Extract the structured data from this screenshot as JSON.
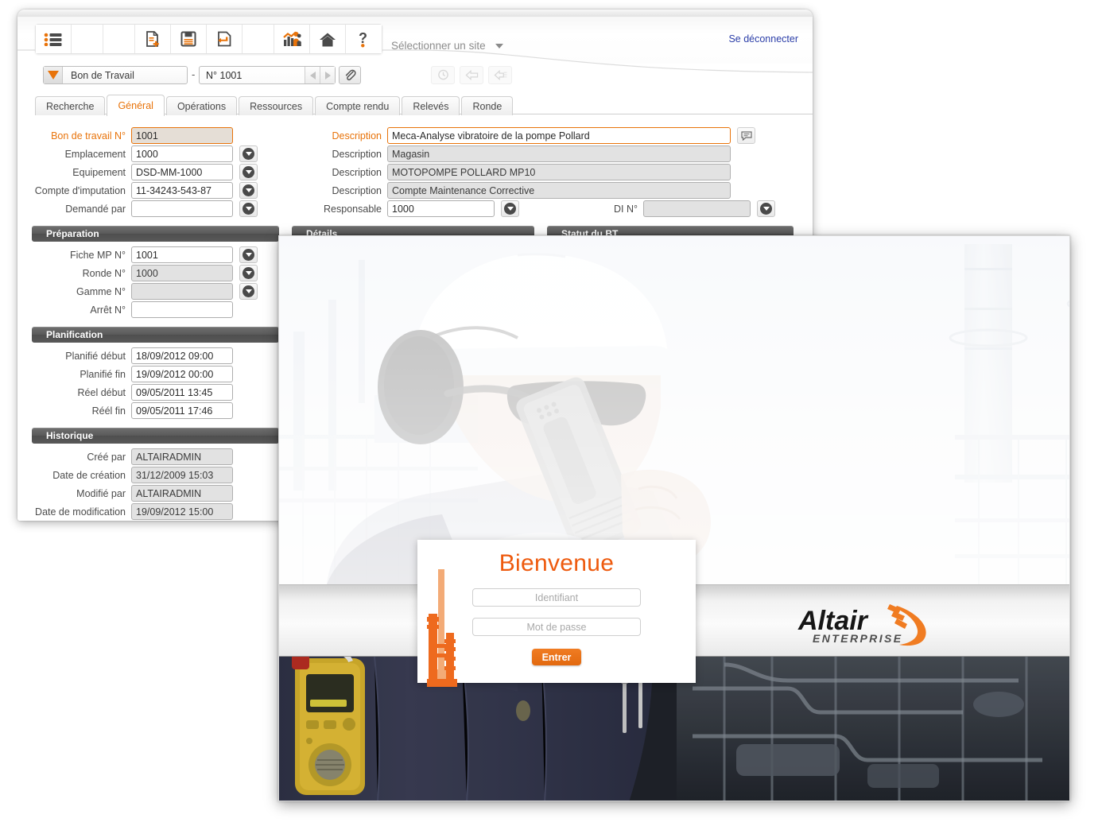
{
  "app": {
    "toolbar": [
      {
        "icon": "list-icon",
        "name": "list"
      },
      {
        "icon": "blank-icon",
        "name": "blank1"
      },
      {
        "icon": "blank-icon",
        "name": "blank2"
      },
      {
        "icon": "new-document-icon",
        "name": "new"
      },
      {
        "icon": "save-floppy-icon",
        "name": "save"
      },
      {
        "icon": "undo-return-icon",
        "name": "undo"
      },
      {
        "icon": "blank-icon",
        "name": "blank3"
      },
      {
        "icon": "chart-people-icon",
        "name": "reports"
      },
      {
        "icon": "home-icon",
        "name": "home"
      },
      {
        "icon": "help-question-icon",
        "name": "help"
      }
    ],
    "site_selector": "Sélectionner un site",
    "logout": "Se déconnecter",
    "record": {
      "type": "Bon de Travail",
      "separator": "-",
      "number": "N° 1001"
    },
    "tabs": [
      {
        "label": "Recherche",
        "active": false
      },
      {
        "label": "Général",
        "active": true
      },
      {
        "label": "Opérations",
        "active": false
      },
      {
        "label": "Ressources",
        "active": false
      },
      {
        "label": "Compte rendu",
        "active": false
      },
      {
        "label": "Relevés",
        "active": false
      },
      {
        "label": "Ronde",
        "active": false
      }
    ],
    "form": {
      "left_top": [
        {
          "label": "Bon de travail N°",
          "value": "1001",
          "state": "focus",
          "dropdown": false,
          "highlight": true
        },
        {
          "label": "Emplacement",
          "value": "1000",
          "state": "normal",
          "dropdown": true,
          "highlight": false
        },
        {
          "label": "Equipement",
          "value": "DSD-MM-1000",
          "state": "normal",
          "dropdown": true,
          "highlight": false
        },
        {
          "label": "Compte d'imputation",
          "value": "11-34243-543-87",
          "state": "normal",
          "dropdown": true,
          "highlight": false
        },
        {
          "label": "Demandé par",
          "value": "",
          "state": "normal",
          "dropdown": true,
          "highlight": false
        }
      ],
      "right_top": [
        {
          "label": "Description",
          "value": "Meca-Analyse vibratoire de la pompe Pollard",
          "state": "focus",
          "highlight": true,
          "comment": true
        },
        {
          "label": "Description",
          "value": "Magasin",
          "state": "readonly",
          "highlight": false,
          "comment": false
        },
        {
          "label": "Description",
          "value": "MOTOPOMPE POLLARD MP10",
          "state": "readonly",
          "highlight": false,
          "comment": false
        },
        {
          "label": "Description",
          "value": "Compte Maintenance Corrective",
          "state": "readonly",
          "highlight": false,
          "comment": false
        }
      ],
      "responsable": {
        "label": "Responsable",
        "value": "1000"
      },
      "di": {
        "label": "DI N°",
        "value": ""
      },
      "sections": [
        {
          "title": "Préparation"
        },
        {
          "title": "Détails"
        },
        {
          "title": "Statut du BT"
        },
        {
          "title": "Planification"
        },
        {
          "title": "Historique"
        }
      ],
      "preparation": [
        {
          "label": "Fiche MP N°",
          "value": "1001",
          "state": "normal",
          "dropdown": true
        },
        {
          "label": "Ronde N°",
          "value": "1000",
          "state": "readonly",
          "dropdown": true
        },
        {
          "label": "Gamme N°",
          "value": "",
          "state": "readonly",
          "dropdown": true
        },
        {
          "label": "Arrêt N°",
          "value": "",
          "state": "normal",
          "dropdown": false
        }
      ],
      "planification": [
        {
          "label": "Planifié début",
          "value": "18/09/2012 09:00"
        },
        {
          "label": "Planifié fin",
          "value": "19/09/2012 00:00"
        },
        {
          "label": "Réel début",
          "value": "09/05/2011 13:45"
        },
        {
          "label": "Réél fin",
          "value": "09/05/2011 17:46"
        }
      ],
      "historique": [
        {
          "label": "Créé par",
          "value": "ALTAIRADMIN"
        },
        {
          "label": "Date de création",
          "value": "31/12/2009 15:03"
        },
        {
          "label": "Modifié par",
          "value": "ALTAIRADMIN"
        },
        {
          "label": "Date de modification",
          "value": "19/09/2012 15:00"
        }
      ]
    }
  },
  "login": {
    "title": "Bienvenue",
    "username_placeholder": "Identifiant",
    "password_placeholder": "Mot de passe",
    "submit_label": "Entrer",
    "logo": {
      "word_main": "Altair",
      "word_sub": "ENTERPRISE"
    }
  },
  "colors": {
    "accent_orange": "#E8730A",
    "welcome_orange": "#EE5A0E",
    "button_orange": "#E2690F",
    "link_blue": "#2b3ea8",
    "section_grey": "#5a5a5a"
  }
}
